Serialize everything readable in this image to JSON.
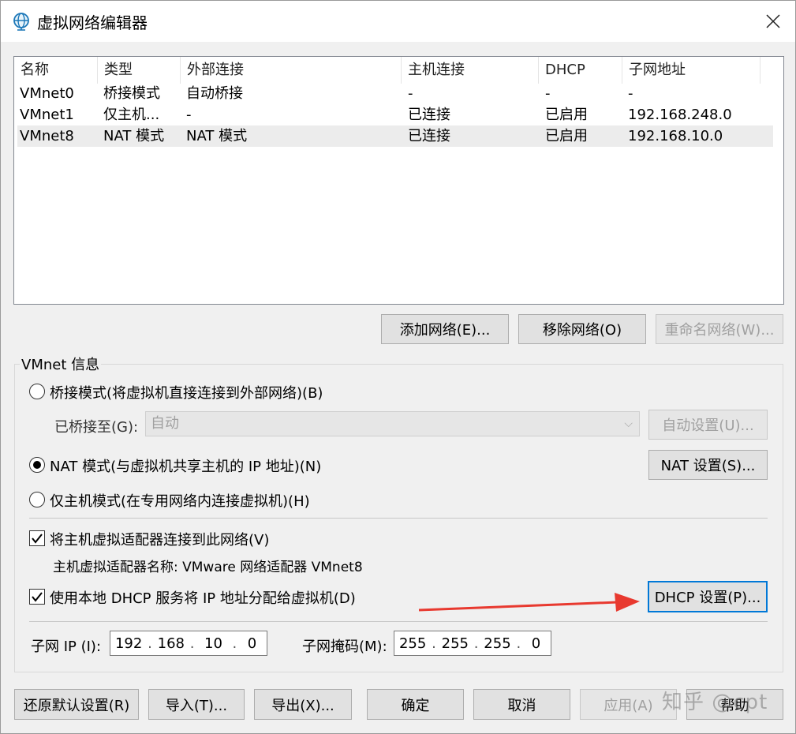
{
  "window": {
    "title": "虚拟网络编辑器"
  },
  "list": {
    "columns": [
      "名称",
      "类型",
      "外部连接",
      "主机连接",
      "DHCP",
      "子网地址"
    ],
    "rows": [
      [
        "VMnet0",
        "桥接模式",
        "自动桥接",
        "-",
        "-",
        "-"
      ],
      [
        "VMnet1",
        "仅主机...",
        "-",
        "已连接",
        "已启用",
        "192.168.248.0"
      ],
      [
        "VMnet8",
        "NAT 模式",
        "NAT 模式",
        "已连接",
        "已启用",
        "192.168.10.0"
      ]
    ],
    "selected_row": 2
  },
  "list_buttons": {
    "add": "添加网络(E)...",
    "remove": "移除网络(O)",
    "rename": "重命名网络(W)..."
  },
  "vmnet_info": {
    "title": "VMnet 信息",
    "bridge_radio": "桥接模式(将虚拟机直接连接到外部网络)(B)",
    "bridged_to_label": "已桥接至(G):",
    "bridged_to_value": "自动",
    "auto_settings": "自动设置(U)...",
    "nat_radio": "NAT 模式(与虚拟机共享主机的 IP 地址)(N)",
    "nat_settings": "NAT 设置(S)...",
    "hostonly_radio": "仅主机模式(在专用网络内连接虚拟机)(H)",
    "connect_adapter_check": "将主机虚拟适配器连接到此网络(V)",
    "adapter_name": "主机虚拟适配器名称: VMware 网络适配器 VMnet8",
    "dhcp_check": "使用本地 DHCP 服务将 IP 地址分配给虚拟机(D)",
    "dhcp_settings": "DHCP 设置(P)...",
    "subnet_ip_label": "子网 IP (I):",
    "subnet_ip": [
      "192",
      "168",
      "10",
      "0"
    ],
    "subnet_mask_label": "子网掩码(M):",
    "subnet_mask": [
      "255",
      "255",
      "255",
      "0"
    ]
  },
  "bottom_buttons": {
    "restore": "还原默认设置(R)",
    "import": "导入(T)...",
    "export": "导出(X)...",
    "ok": "确定",
    "cancel": "取消",
    "apply": "应用(A)",
    "help": "帮助"
  },
  "watermark": "知乎 @cpt",
  "colors": {
    "accent": "#0078d7",
    "arrow": "#e8392f"
  }
}
